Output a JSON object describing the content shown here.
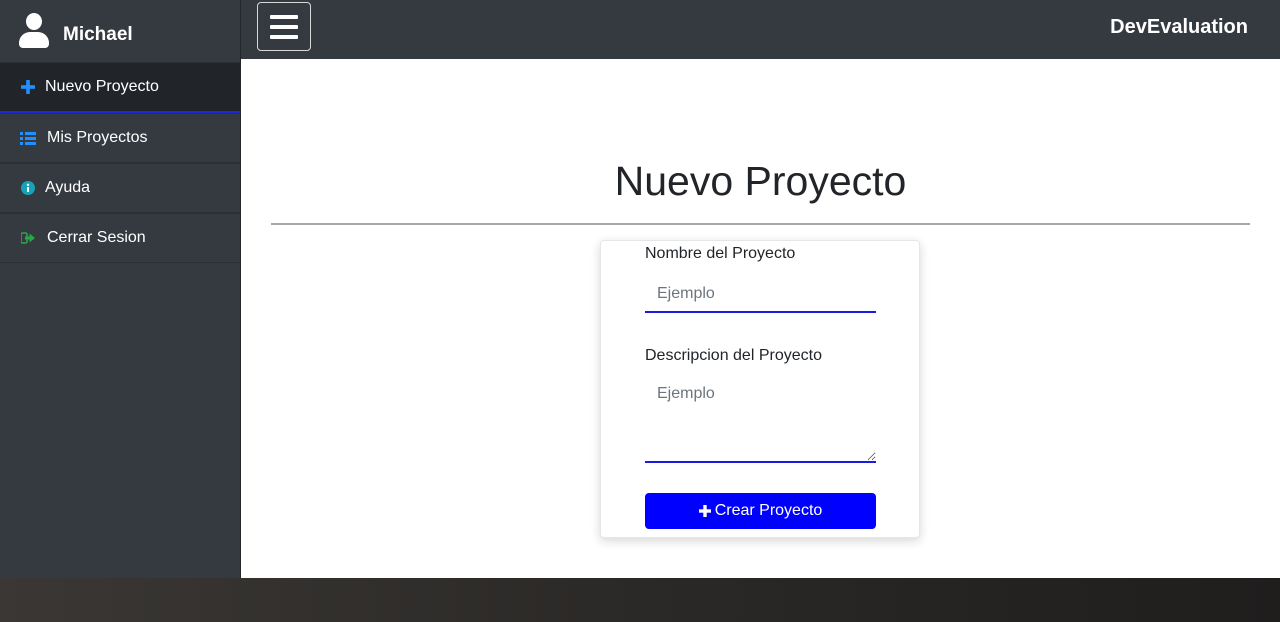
{
  "sidebar": {
    "user_name": "Michael",
    "user_icon": "user-icon",
    "items": [
      {
        "label": "Nuevo Proyecto",
        "icon": "plus-icon",
        "icon_color": "#1e90ff",
        "active": true
      },
      {
        "label": "Mis Proyectos",
        "icon": "list-icon",
        "icon_color": "#1e90ff",
        "active": false
      },
      {
        "label": "Ayuda",
        "icon": "info-icon",
        "icon_color": "#17a2b8",
        "active": false
      },
      {
        "label": "Cerrar Sesion",
        "icon": "sign-out-icon",
        "icon_color": "#28a745",
        "active": false
      }
    ]
  },
  "topbar": {
    "menu_icon": "hamburger-icon",
    "brand": "DevEvaluation"
  },
  "main": {
    "title": "Nuevo Proyecto"
  },
  "form": {
    "name_label": "Nombre del Proyecto",
    "name_placeholder": "Ejemplo",
    "name_value": "",
    "description_label": "Descripcion del Proyecto",
    "description_placeholder": "Ejemplo",
    "description_value": "",
    "submit_label": "Crear Proyecto",
    "submit_icon": "plus-icon",
    "accent_color": "#0000ff"
  }
}
